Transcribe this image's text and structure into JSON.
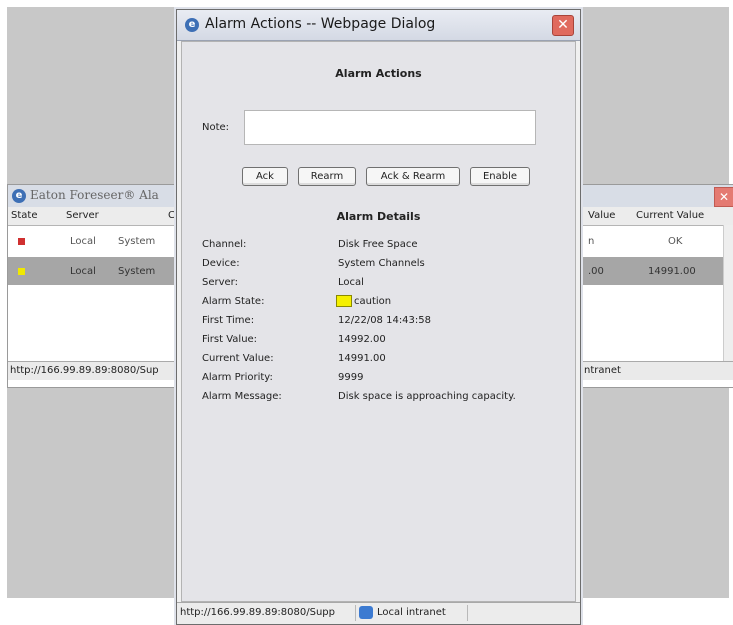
{
  "background_window": {
    "title": "Eaton Foreseer® Ala",
    "columns": {
      "state": "State",
      "server": "Server",
      "c": "C",
      "value": "Value",
      "current_value": "Current Value"
    },
    "rows": [
      {
        "state_color": "#d03030",
        "server": "Local",
        "c": "System",
        "value": "n",
        "current_value": "OK"
      },
      {
        "state_color": "#f0e800",
        "server": "Local",
        "c": "System",
        "value": ".00",
        "current_value": "14991.00"
      }
    ],
    "status": {
      "url": "http://166.99.89.89:8080/Sup",
      "zone": "ntranet"
    }
  },
  "dialog": {
    "title": "Alarm Actions -- Webpage Dialog",
    "section_actions": "Alarm Actions",
    "note_label": "Note:",
    "note_value": "",
    "buttons": {
      "ack": "Ack",
      "rearm": "Rearm",
      "ack_rearm": "Ack & Rearm",
      "enable": "Enable"
    },
    "section_details": "Alarm Details",
    "details": [
      {
        "label": "Channel:",
        "value": "Disk Free Space"
      },
      {
        "label": "Device:",
        "value": "System Channels"
      },
      {
        "label": "Server:",
        "value": "Local"
      },
      {
        "label": "Alarm State:",
        "value": "caution"
      },
      {
        "label": "First Time:",
        "value": "12/22/08 14:43:58"
      },
      {
        "label": "First Value:",
        "value": "14992.00"
      },
      {
        "label": "Current Value:",
        "value": "14991.00"
      },
      {
        "label": "Alarm Priority:",
        "value": "9999"
      },
      {
        "label": "Alarm Message:",
        "value": "Disk space is approaching capacity."
      }
    ],
    "caution_color": "#f5f000",
    "status": {
      "url": "http://166.99.89.89:8080/Supp",
      "zone": "Local intranet"
    }
  }
}
